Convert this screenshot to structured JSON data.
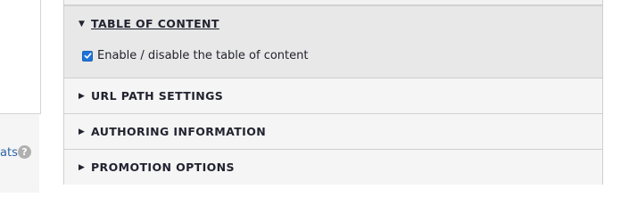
{
  "sidebar": {
    "formats_link": "ats",
    "help_icon": "?"
  },
  "accordion": {
    "sections": [
      {
        "title": "TABLE OF CONTENT",
        "expanded": true,
        "checkbox_label": "Enable / disable the table of content",
        "checkbox_checked": true
      },
      {
        "title": "URL PATH SETTINGS",
        "expanded": false
      },
      {
        "title": "AUTHORING INFORMATION",
        "expanded": false
      },
      {
        "title": "PROMOTION OPTIONS",
        "expanded": false
      }
    ],
    "icons": {
      "expanded": "triangle-down-icon",
      "collapsed": "triangle-right-icon"
    }
  },
  "colors": {
    "link": "#2c63a8",
    "checkbox": "#1e73d8"
  }
}
